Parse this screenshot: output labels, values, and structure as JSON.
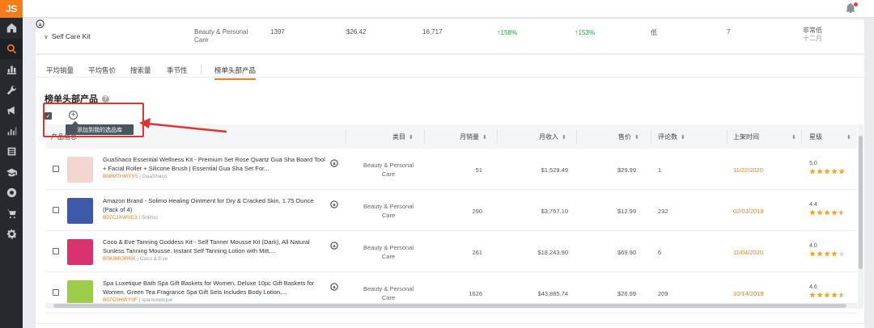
{
  "app": {
    "logo": "JS"
  },
  "rail": {
    "icons": [
      "home-icon",
      "search-icon",
      "chart-icon",
      "tools-icon",
      "megaphone-icon",
      "bars-icon",
      "list-icon",
      "graduation-icon",
      "chrome-icon",
      "cart-icon",
      "settings-icon"
    ]
  },
  "summary": {
    "name": "Self Care Kit",
    "category": "Beauty & Personal Care",
    "search_volume": "1397",
    "avg_price": "$26.42",
    "total_sales": "16,717",
    "growth_1": "158%",
    "growth_2": "153%",
    "competition": "低",
    "count": "7",
    "season": "非常低",
    "season_sub": "十二月"
  },
  "tabs": [
    {
      "label": "平均销量"
    },
    {
      "label": "平均售价"
    },
    {
      "label": "搜索量"
    },
    {
      "label": "季节性"
    },
    {
      "label": "榜单头部产品"
    }
  ],
  "section": {
    "title": "榜单头部产品",
    "help": "?"
  },
  "toolbar": {
    "check_mark": "✓",
    "add_symbol": "+",
    "tooltip": "添加到我的选品库"
  },
  "table": {
    "headers": {
      "product": "产品信息",
      "category": "类目",
      "monthly_sales": "月销量",
      "monthly_revenue": "月收入",
      "price": "售价",
      "reviews": "评论数",
      "listed": "上架时间",
      "rating": "星级"
    },
    "sort_glyph": "⬍",
    "rows": [
      {
        "title": "GuaShaco Essential Wellness Kit - Premium Set Rose Quartz Gua Sha Board Tool + Facial Roller + Silicone Brush | Essential Gua Sha Set For...",
        "asin": "B08MTHMYY5",
        "brand": "GuaShaco",
        "category": "Beauty & Personal Care",
        "sales": "51",
        "revenue": "$1,529.49",
        "price": "$29.99",
        "reviews": "1",
        "date": "11/22/2020",
        "rating": "5.0",
        "stars": 5,
        "thumb_color": "#f2d6cf"
      },
      {
        "title": "Amazon Brand - Solimo Healing Ointment for Dry & Cracked Skin, 1.75 Ounce (Pack of 4)",
        "asin": "B07CJXWSC3",
        "brand": "Solimo",
        "category": "Beauty & Personal Care",
        "sales": "290",
        "revenue": "$3,767.10",
        "price": "$12.99",
        "reviews": "232",
        "date": "02/03/2019",
        "rating": "4.4",
        "stars": 4.5,
        "thumb_color": "#3d59a8"
      },
      {
        "title": "Coco & Eve Tanning Goddess Kit - Self Tanner Mousse Kit (Dark), All Natural Sunless Tanning Mousse, Instant Self Tanning Lotion with Mitt,...",
        "asin": "B08J6R3RRK",
        "brand": "Coco & Eve",
        "category": "Beauty & Personal Care",
        "sales": "261",
        "revenue": "$18,243.90",
        "price": "$69.90",
        "reviews": "6",
        "date": "11/04/2020",
        "rating": "4.0",
        "stars": 4,
        "thumb_color": "#d8336e"
      },
      {
        "title": "Spa Luxetique Bath Spa Gift Baskets for Women, Deluxe 10pc Gift Baskets for Women, Green Tea Fragrance Spa Gift Sets Includes Body Lotion,...",
        "asin": "B07C5HWY3F",
        "brand": "spa luxetique",
        "category": "Beauty & Personal Care",
        "sales": "1626",
        "revenue": "$43,885.74",
        "price": "$26.99",
        "reviews": "209",
        "date": "10/14/2018",
        "rating": "4.6",
        "stars": 4.5,
        "thumb_color": "#9ccc4a"
      }
    ]
  },
  "colors": {
    "accent": "#f47c1a",
    "star": "#f5a623",
    "highlight": "#e0342f",
    "growth": "#2aa24a"
  }
}
